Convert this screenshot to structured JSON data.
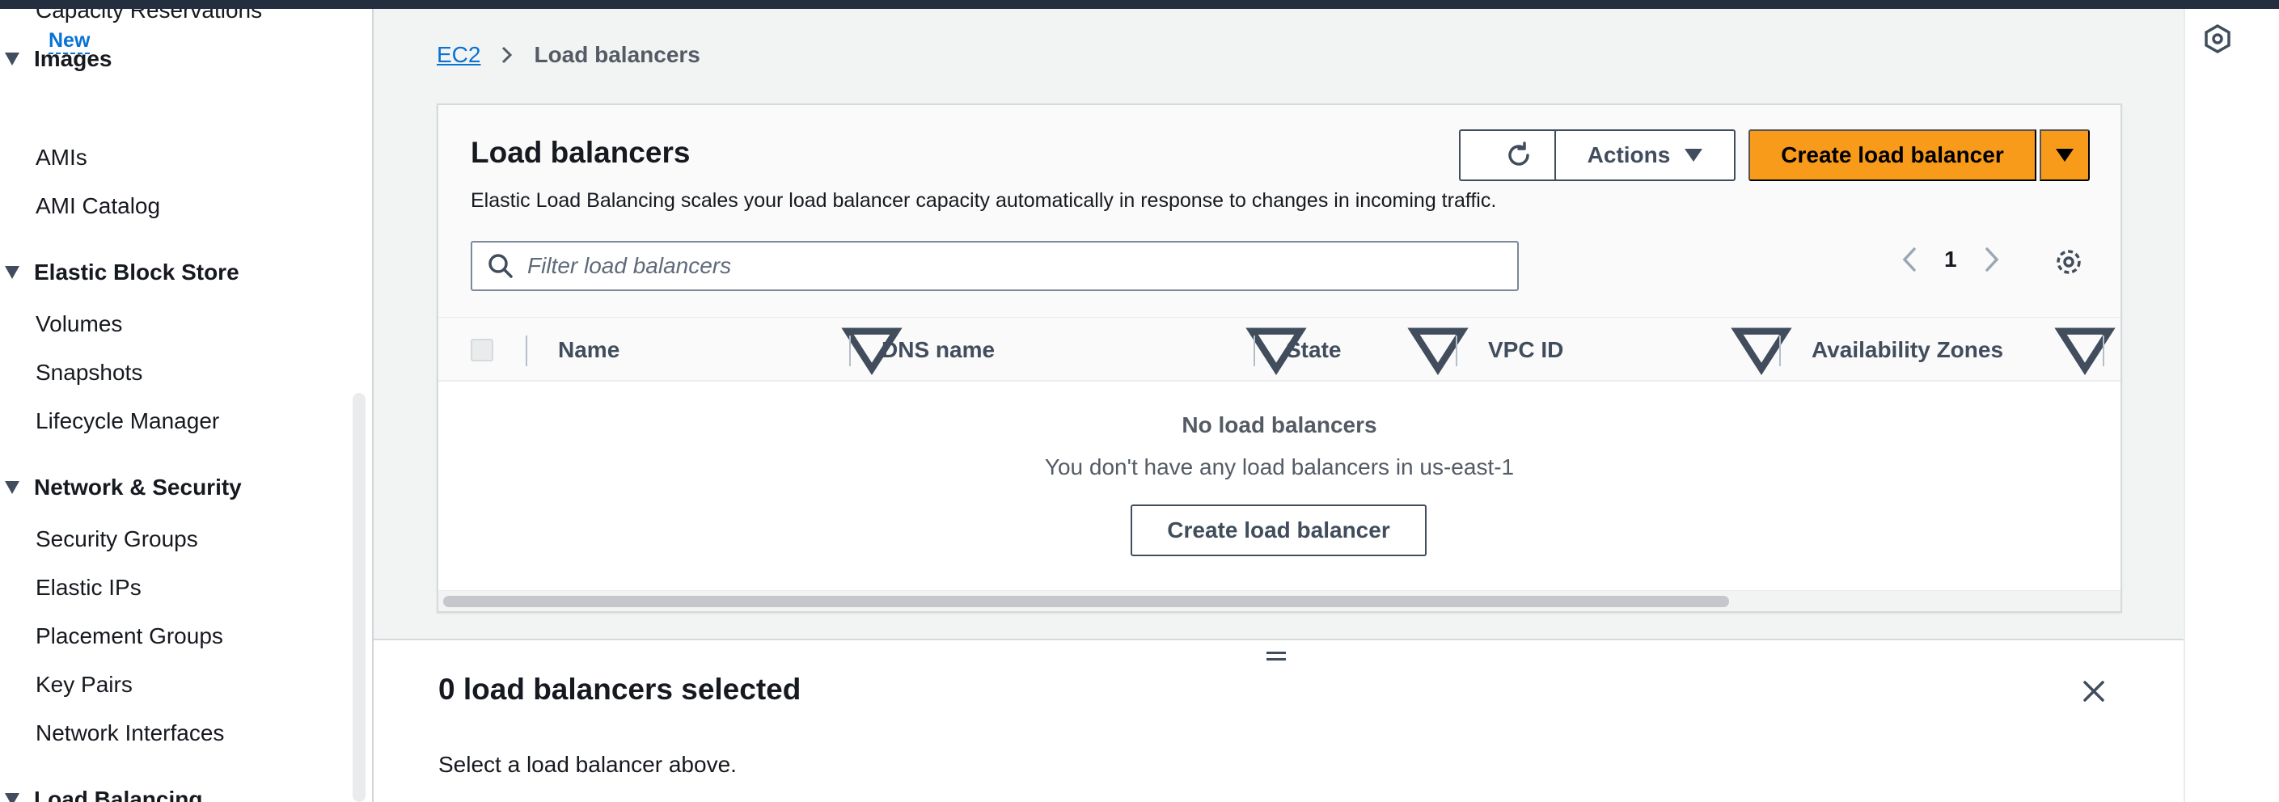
{
  "sidebar": {
    "cut_item": "Capacity Reservations",
    "new_badge": "New",
    "sections": [
      {
        "label": "Images",
        "items": [
          "AMIs",
          "AMI Catalog"
        ]
      },
      {
        "label": "Elastic Block Store",
        "items": [
          "Volumes",
          "Snapshots",
          "Lifecycle Manager"
        ]
      },
      {
        "label": "Network & Security",
        "items": [
          "Security Groups",
          "Elastic IPs",
          "Placement Groups",
          "Key Pairs",
          "Network Interfaces"
        ]
      },
      {
        "label": "Load Balancing",
        "items": []
      }
    ]
  },
  "breadcrumb": {
    "root": "EC2",
    "current": "Load balancers"
  },
  "container": {
    "title": "Load balancers",
    "description": "Elastic Load Balancing scales your load balancer capacity automatically in response to changes in incoming traffic.",
    "actions_label": "Actions",
    "create_label": "Create load balancer",
    "filter_placeholder": "Filter load balancers",
    "page_number": "1"
  },
  "table": {
    "columns": [
      "Name",
      "DNS name",
      "State",
      "VPC ID",
      "Availability Zones"
    ]
  },
  "empty_state": {
    "title": "No load balancers",
    "subtitle": "You don't have any load balancers in us-east-1",
    "button": "Create load balancer"
  },
  "split_panel": {
    "title": "0 load balancers selected",
    "message": "Select a load balancer above."
  },
  "colors": {
    "accent": "#f89b1b",
    "link": "#0972d3",
    "header_bar": "#232f3e"
  }
}
